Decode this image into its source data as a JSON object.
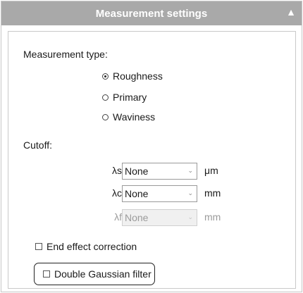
{
  "header": {
    "title": "Measurement settings",
    "collapse_glyph": "▲"
  },
  "measurement_type": {
    "label": "Measurement type:",
    "options": [
      {
        "label": "Roughness",
        "selected": true
      },
      {
        "label": "Primary",
        "selected": false
      },
      {
        "label": "Waviness",
        "selected": false
      }
    ]
  },
  "cutoff": {
    "label": "Cutoff:",
    "rows": [
      {
        "symbol": "λs",
        "value": "None",
        "unit": "μm",
        "enabled": true
      },
      {
        "symbol": "λc",
        "value": "None",
        "unit": "mm",
        "enabled": true
      },
      {
        "symbol": "λf",
        "value": "None",
        "unit": "mm",
        "enabled": false
      }
    ]
  },
  "options": {
    "end_effect": {
      "label": "End effect correction",
      "checked": false
    },
    "double_gaussian": {
      "label": "Double Gaussian filter",
      "checked": false
    }
  },
  "colors": {
    "header_bg": "#a9a9a9",
    "border": "#c9c9c9",
    "highlight": "#222222"
  }
}
